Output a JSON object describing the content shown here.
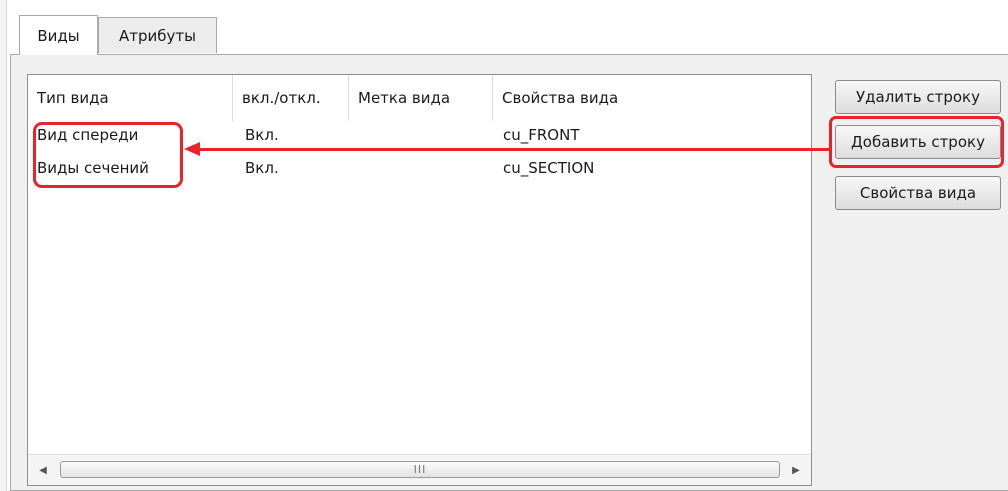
{
  "tabs": [
    {
      "label": "Виды",
      "active": true
    },
    {
      "label": "Атрибуты",
      "active": false
    }
  ],
  "table": {
    "columns": [
      "Тип вида",
      "вкл./откл.",
      "Метка вида",
      "Свойства вида"
    ],
    "rows": [
      [
        "Вид спереди",
        "Вкл.",
        "",
        "cu_FRONT"
      ],
      [
        "Виды сечений",
        "Вкл.",
        "",
        "cu_SECTION"
      ]
    ]
  },
  "scrollbar": {
    "left_arrow": "◀",
    "right_arrow": "▶",
    "grip": "III"
  },
  "buttons": {
    "delete_row": "Удалить строку",
    "add_row": "Добавить строку",
    "view_properties": "Свойства вида"
  },
  "annotation": {
    "color": "#e8232a"
  }
}
